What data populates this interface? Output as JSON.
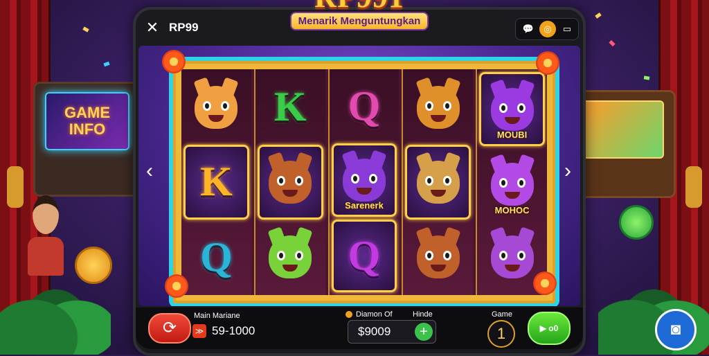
{
  "app": {
    "title": "RP99",
    "close_icon": "close-icon"
  },
  "top_tools": {
    "icons": [
      "chat-icon",
      "coin-icon",
      "wallet-icon"
    ]
  },
  "logo": {
    "main": "RP991",
    "sub": "Menarik Menguntungkan"
  },
  "background_signs": {
    "left": "GAME INFO"
  },
  "reels": [
    [
      {
        "type": "face",
        "color": "#f0a040",
        "label": ""
      },
      {
        "type": "letter",
        "text": "K",
        "color": "#ffb428",
        "label": "",
        "boxed": true
      },
      {
        "type": "letter",
        "text": "Q",
        "color": "#2ab4d6",
        "label": ""
      }
    ],
    [
      {
        "type": "letter",
        "text": "K",
        "color": "#3acb4a",
        "label": ""
      },
      {
        "type": "face",
        "color": "#c0602a",
        "label": "",
        "boxed": true
      },
      {
        "type": "face",
        "color": "#7ad23a",
        "label": ""
      }
    ],
    [
      {
        "type": "letter",
        "text": "Q",
        "color": "#e24ab0",
        "label": ""
      },
      {
        "type": "face",
        "color": "#8a3ad6",
        "label": "Sarenerk",
        "boxed": true
      },
      {
        "type": "letter",
        "text": "Q",
        "color": "#c23ae0",
        "label": "",
        "boxed": true
      }
    ],
    [
      {
        "type": "face",
        "color": "#e0902a",
        "label": ""
      },
      {
        "type": "face",
        "color": "#d6a04a",
        "label": "",
        "boxed": true
      },
      {
        "type": "face",
        "color": "#c0602a",
        "label": ""
      }
    ],
    [
      {
        "type": "face",
        "color": "#9a3ae0",
        "label": "MOUBI",
        "boxed": true
      },
      {
        "type": "face",
        "color": "#b44ae6",
        "label": "MOHOC"
      },
      {
        "type": "face",
        "color": "#a64ad6",
        "label": ""
      }
    ]
  ],
  "controls": {
    "spin_icon": "refresh-icon",
    "balance_label": "Main Mariane",
    "balance_value": "59-1000",
    "bet_label": "Diamon Of",
    "bet_limit_label": "Hinde",
    "bet_value": "$9009",
    "round_label": "Game",
    "round_value": "1",
    "play_label": "▶ o0"
  },
  "colors": {
    "accent_red": "#e23a1a",
    "accent_green": "#3ac24a",
    "frame_cyan": "#2ed3e6",
    "gold": "#ffcc3a"
  }
}
